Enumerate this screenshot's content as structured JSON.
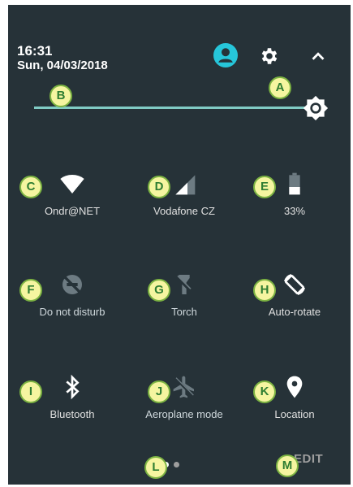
{
  "header": {
    "time": "16:31",
    "date": "Sun, 04/03/2018"
  },
  "icons": {
    "account": "account-circle-icon",
    "settings": "gear-icon",
    "collapse": "chevron-up-icon",
    "brightness": "brightness-icon"
  },
  "tiles": [
    {
      "label": "Ondr@NET",
      "icon": "wifi-icon"
    },
    {
      "label": "Vodafone CZ",
      "icon": "cellular-signal-icon"
    },
    {
      "label": "33%",
      "icon": "battery-icon"
    },
    {
      "label": "Do not disturb",
      "icon": "do-not-disturb-icon"
    },
    {
      "label": "Torch",
      "icon": "flashlight-icon"
    },
    {
      "label": "Auto-rotate",
      "icon": "rotate-icon"
    },
    {
      "label": "Bluetooth",
      "icon": "bluetooth-icon"
    },
    {
      "label": "Aeroplane mode",
      "icon": "airplane-icon"
    },
    {
      "label": "Location",
      "icon": "location-pin-icon"
    }
  ],
  "callouts": [
    "A",
    "B",
    "C",
    "D",
    "E",
    "F",
    "G",
    "H",
    "I",
    "J",
    "K",
    "L",
    "M"
  ],
  "footer": {
    "edit_label": "EDIT",
    "page_count": 2,
    "current_page": 1
  },
  "colors": {
    "panel_bg": "#263238",
    "accent": "#80cbc4",
    "avatar": "#26c6da",
    "callout_fill": "#f5f5a0",
    "callout_border": "#7cb342"
  }
}
